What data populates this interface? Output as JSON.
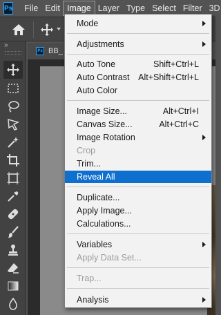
{
  "app": {
    "logo_text": "Ps"
  },
  "menubar": {
    "items": [
      "File",
      "Edit",
      "Image",
      "Layer",
      "Type",
      "Select",
      "Filter",
      "3D"
    ],
    "active_item": "Image"
  },
  "document": {
    "tab_label": "BB_",
    "icon_text": "Ps"
  },
  "toolbar": {
    "collapse_glyph": "»",
    "tools": [
      "move-tool-icon",
      "marquee-tool-icon",
      "lasso-tool-icon",
      "object-select-tool-icon",
      "magic-wand-tool-icon",
      "crop-tool-icon",
      "frame-tool-icon",
      "eyedropper-tool-icon",
      "healing-brush-tool-icon",
      "brush-tool-icon",
      "clone-stamp-tool-icon",
      "eraser-tool-icon",
      "gradient-tool-icon",
      "blur-tool-icon"
    ]
  },
  "image_menu": {
    "mode": "Mode",
    "adjustments": "Adjustments",
    "auto_tone": {
      "label": "Auto Tone",
      "shortcut": "Shift+Ctrl+L"
    },
    "auto_contrast": {
      "label": "Auto Contrast",
      "shortcut": "Alt+Shift+Ctrl+L"
    },
    "auto_color": "Auto Color",
    "image_size": {
      "label": "Image Size...",
      "shortcut": "Alt+Ctrl+I"
    },
    "canvas_size": {
      "label": "Canvas Size...",
      "shortcut": "Alt+Ctrl+C"
    },
    "image_rotation": "Image Rotation",
    "crop": "Crop",
    "trim": "Trim...",
    "reveal_all": "Reveal All",
    "duplicate": "Duplicate...",
    "apply_image": "Apply Image...",
    "calculations": "Calculations...",
    "variables": "Variables",
    "apply_data_set": "Apply Data Set...",
    "trap": "Trap...",
    "analysis": "Analysis"
  },
  "colors": {
    "highlight": "#0f6fcf",
    "menu_bg": "#f2f2f2",
    "disabled_text": "#9c9c9c",
    "ps_blue": "#31a8ff"
  }
}
